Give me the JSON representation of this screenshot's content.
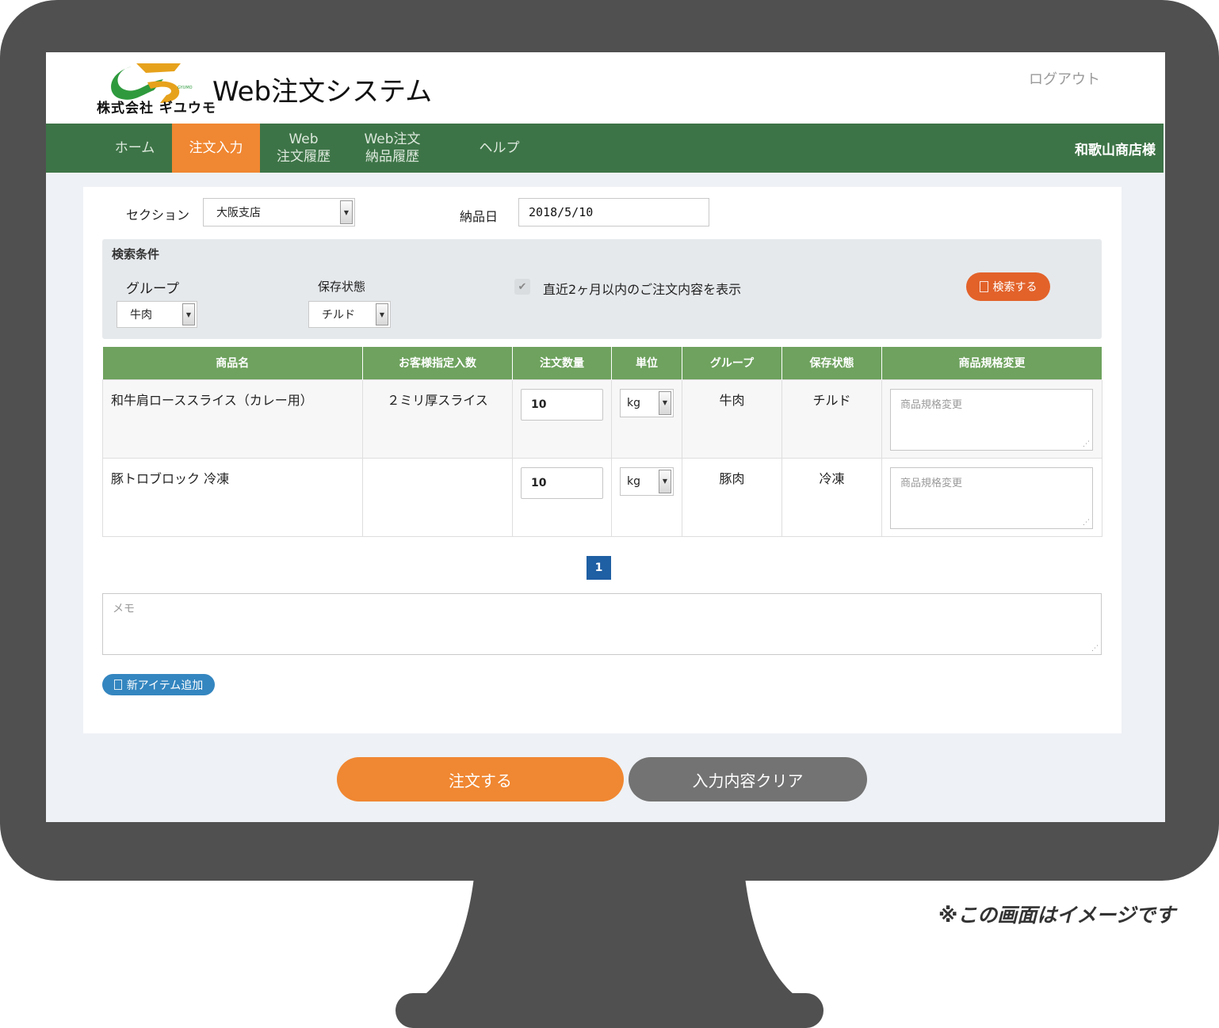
{
  "header": {
    "logo_company": "株式会社 ギユウモ",
    "logo_mark": "GYUMO",
    "title": "Web注文システム",
    "logout": "ログアウト"
  },
  "nav": {
    "items": [
      {
        "label": "ホーム",
        "active": false
      },
      {
        "label": "注文入力",
        "active": true
      },
      {
        "label": "Web\n注文履歴",
        "active": false
      },
      {
        "label": "Web注文\n納品履歴",
        "active": false
      },
      {
        "label": "ヘルプ",
        "active": false
      }
    ],
    "user": "和歌山商店様"
  },
  "form": {
    "section_label": "セクション",
    "section_value": "大阪支店",
    "delivery_label": "納品日",
    "delivery_value": "2018/5/10"
  },
  "search": {
    "title": "検索条件",
    "group_label": "グループ",
    "group_value": "牛肉",
    "storage_label": "保存状態",
    "storage_value": "チルド",
    "recent_label": "直近2ヶ月以内のご注文内容を表示",
    "recent_checked": true,
    "button": "検索する"
  },
  "table": {
    "headers": [
      "商品名",
      "お客様指定入数",
      "注文数量",
      "単位",
      "グループ",
      "保存状態",
      "商品規格変更"
    ],
    "rows": [
      {
        "name": "和牛肩ローススライス（カレー用）",
        "spec_qty": "２ミリ厚スライス",
        "qty": "10",
        "unit": "kg",
        "group": "牛肉",
        "storage": "チルド",
        "spec_placeholder": "商品規格変更"
      },
      {
        "name": "豚トロブロック 冷凍",
        "spec_qty": "",
        "qty": "10",
        "unit": "kg",
        "group": "豚肉",
        "storage": "冷凍",
        "spec_placeholder": "商品規格変更"
      }
    ]
  },
  "pager": {
    "current": "1"
  },
  "memo": {
    "placeholder": "メモ"
  },
  "add_item": "新アイテム追加",
  "actions": {
    "order": "注文する",
    "clear": "入力内容クリア"
  },
  "note": "※この画面はイメージです",
  "colors": {
    "nav_green": "#3d7447",
    "table_green": "#6ea25e",
    "accent_orange": "#f08732",
    "search_btn": "#e2622a",
    "add_btn": "#3486c0",
    "clear_gray": "#737373",
    "pager_blue": "#1f5fa3"
  },
  "icons": {
    "search_button": "document-icon",
    "add_button": "document-icon",
    "checkbox": "check-icon"
  }
}
